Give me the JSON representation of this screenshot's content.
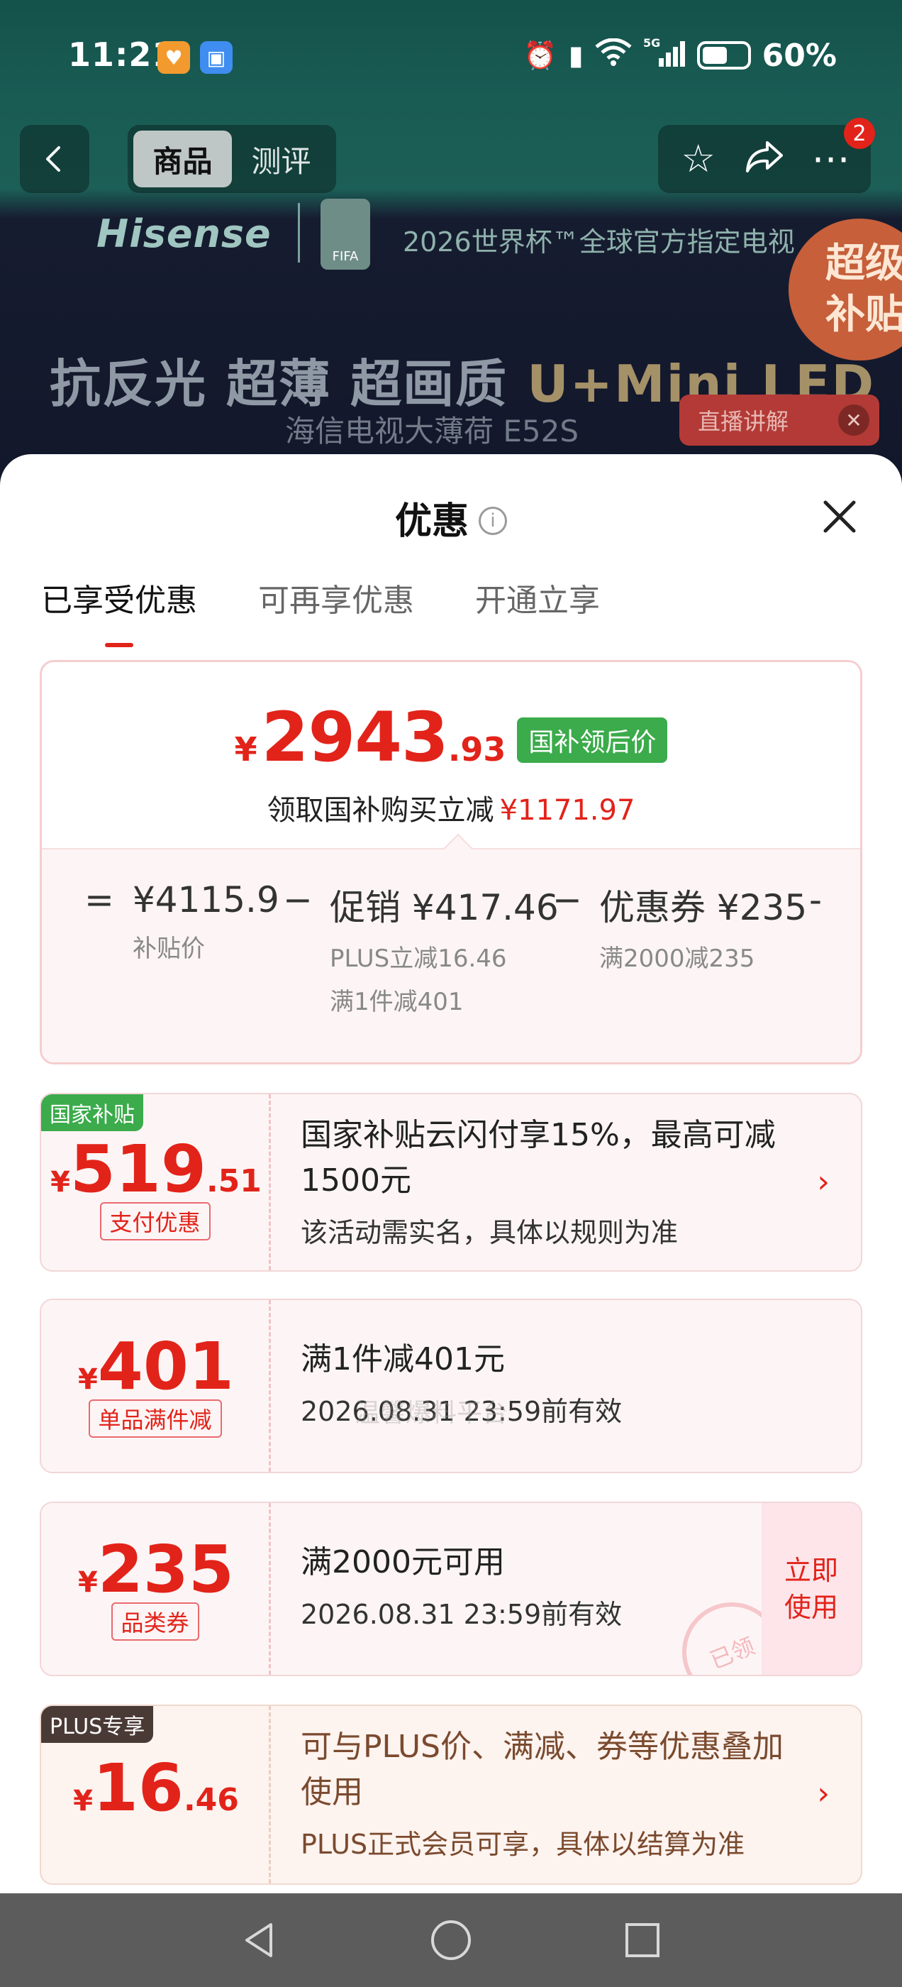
{
  "status_bar": {
    "time": "11:21",
    "battery": "60%",
    "network": "5G"
  },
  "nav": {
    "tabs": [
      "商品",
      "测评"
    ],
    "active_tab": 0,
    "badge_count": "2"
  },
  "banner": {
    "brand": "Hisense",
    "fifa_label": "FIFA",
    "slogan": "2026世界杯™全球官方指定电视",
    "promo_badge": [
      "超级",
      "补贴"
    ],
    "headline_main": "抗反光 超薄 超画质 ",
    "headline_accent": "U+Mini LED",
    "subhead": "海信电视大薄荷 E52S",
    "live_label": "直播讲解"
  },
  "sheet": {
    "title": "优惠",
    "tabs": [
      "已享受优惠",
      "可再享优惠",
      "开通立享"
    ],
    "active_tab": 0
  },
  "summary": {
    "currency": "¥",
    "price_int": "2943",
    "price_dec": ".93",
    "price_tag": "国补领后价",
    "save_text": "领取国补购买立减",
    "save_amount": "¥1171.97",
    "breakdown": [
      {
        "op": "=",
        "amount": "¥4115.9",
        "label": "补贴价"
      },
      {
        "op": "−",
        "amount": "促销 ¥417.46",
        "label": "PLUS立减16.46",
        "label2": "满1件减401"
      },
      {
        "op": "−",
        "amount": "优惠券 ¥235",
        "label": "满2000减235"
      },
      {
        "op": "-"
      }
    ]
  },
  "coupons": [
    {
      "corner": "国家补贴",
      "currency": "¥",
      "int": "519",
      "dec": ".51",
      "tag": "支付优惠",
      "title": "国家补贴云闪付享15%，最高可减1500元",
      "desc": "该活动需实名，具体以规则为准"
    },
    {
      "currency": "¥",
      "int": "401",
      "dec": "",
      "tag": "单品满件减",
      "title": "满1件减401元",
      "desc": "2026.08.31 23:59前有效"
    },
    {
      "currency": "¥",
      "int": "235",
      "dec": "",
      "tag": "品类券",
      "title": "满2000元可用",
      "desc": "2026.08.31 23:59前有效",
      "claim": [
        "立即",
        "使用"
      ],
      "stamp": "已领"
    },
    {
      "corner": "PLUS专享",
      "currency": "¥",
      "int": "16",
      "dec": ".46",
      "title": "可与PLUS价、满减、券等优惠叠加使用",
      "desc": "PLUS正式会员可享，具体以结算为准"
    }
  ],
  "watermark": "温馨爆料平台",
  "colors": {
    "accent_red": "#e2231a",
    "tag_green": "#3bab4b"
  }
}
